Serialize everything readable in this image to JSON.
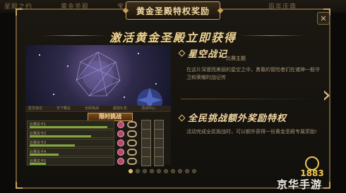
{
  "back_tabs": [
    "星殿之约",
    "黄金圣殿",
    "宝石",
    "周年庆典"
  ],
  "window": {
    "title": "黄金圣殿特权奖励",
    "close_icon": "close-icon"
  },
  "headline": "激活黄金圣殿立即获得",
  "screenshot": {
    "tabs": [
      "星空战记",
      "天下霸业",
      "全民挑战",
      "超值礼包",
      "活动中心"
    ],
    "event_label": "限时挑战",
    "rows": [
      {
        "name": "比赛关卡1",
        "progress": 0.95
      },
      {
        "name": "比赛关卡2",
        "progress": 0.75
      },
      {
        "name": "比赛关卡3",
        "progress": 0.55
      },
      {
        "name": "比赛关卡4",
        "progress": 0.35
      },
      {
        "name": "比赛关卡5",
        "progress": 0.2
      }
    ]
  },
  "features": [
    {
      "title": "星空战记",
      "subtitle": "比赛主题",
      "description": "在这片深邃而美丽的星空之中，勇敢的冒险者们在诸神一般守卫和荣耀的战记传"
    },
    {
      "title": "全民挑战额外奖励特权",
      "subtitle": "",
      "description": "活动完成全民挑战时，可以额外获得一份黄金圣殿专属奖励!"
    }
  ],
  "pagination": {
    "count": 10,
    "active_index": 0
  },
  "watermark": {
    "logo": "1883",
    "text": "京华手游"
  },
  "colors": {
    "gold": "#c9a15a",
    "title": "#f2d9a0",
    "active_dot": "#e8b04e"
  }
}
